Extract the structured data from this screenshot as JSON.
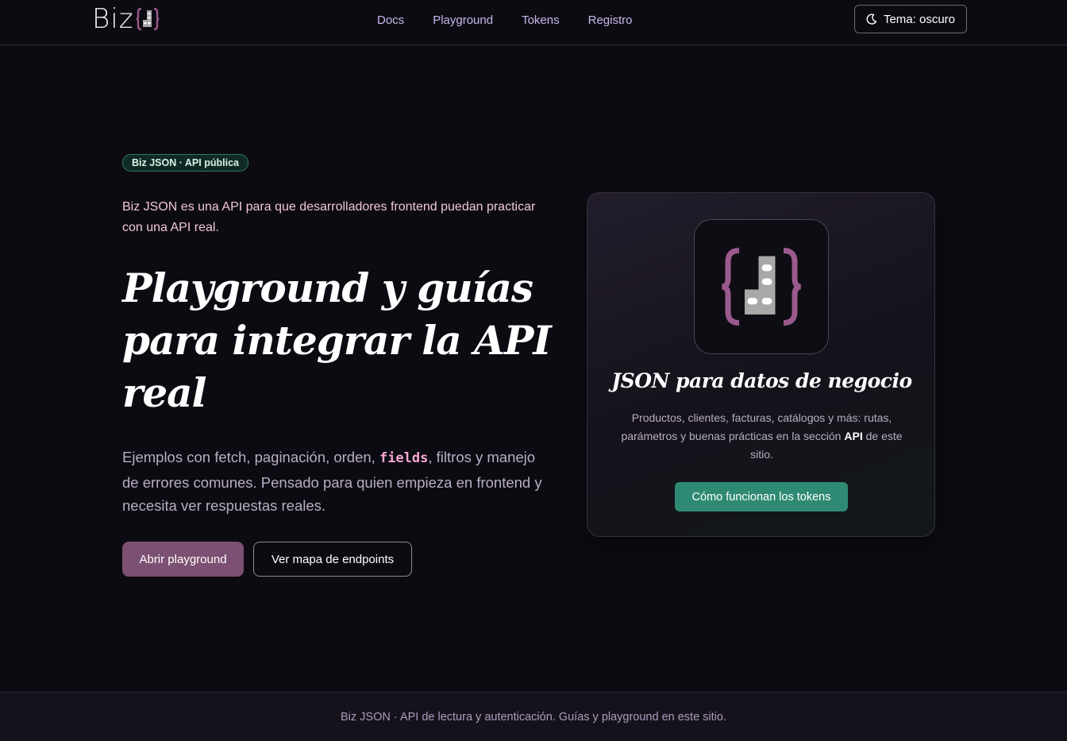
{
  "header": {
    "logo_text": "Biz",
    "nav": [
      {
        "label": "Docs"
      },
      {
        "label": "Playground"
      },
      {
        "label": "Tokens"
      },
      {
        "label": "Registro"
      }
    ],
    "theme_button": "Tema: oscuro"
  },
  "hero": {
    "badge": "Biz JSON · API pública",
    "intro": "Biz JSON es una API para que desarrolladores frontend puedan practicar con una API real.",
    "title": "Playground y guías para integrar la API real",
    "desc_before": "Ejemplos con fetch, paginación, orden, ",
    "desc_code": "fields",
    "desc_after": ", filtros y manejo de errores comunes. Pensado para quien empieza en frontend y necesita ver respuestas reales.",
    "primary_button": "Abrir playground",
    "secondary_button": "Ver mapa de endpoints"
  },
  "card": {
    "title": "JSON para datos de negocio",
    "text_before": "Productos, clientes, facturas, catálogos y más: rutas, parámetros y buenas prácticas en la sección ",
    "text_bold": "API",
    "text_after": " de este sitio.",
    "button": "Cómo funcionan los tokens"
  },
  "footer": {
    "text": "Biz JSON · API de lectura y autenticación. Guías y playground en este sitio."
  },
  "colors": {
    "background": "#0d0b12",
    "brand_purple": "#9a5a8c",
    "primary_button": "#7c5072",
    "accent_green": "#2f8a73",
    "nav_text": "#c6b8ea"
  },
  "icons": [
    "brand-logo-icon",
    "moon-icon"
  ]
}
